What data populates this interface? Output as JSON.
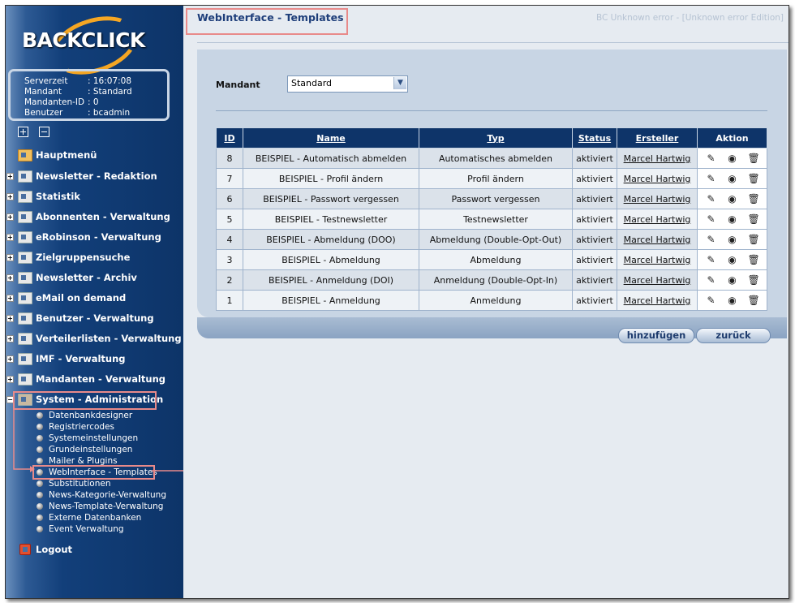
{
  "logo_text": "BACKCLICK",
  "info": {
    "rows": [
      {
        "key": "Serverzeit",
        "value": ": 16:07:08"
      },
      {
        "key": "Mandant",
        "value": ": Standard"
      },
      {
        "key": "Mandanten-ID",
        "value": ": 0"
      },
      {
        "key": "Benutzer",
        "value": ": bcadmin"
      }
    ]
  },
  "menu": [
    {
      "label": "Hauptmenü"
    },
    {
      "label": "Newsletter - Redaktion"
    },
    {
      "label": "Statistik"
    },
    {
      "label": "Abonnenten - Verwaltung"
    },
    {
      "label": "eRobinson - Verwaltung"
    },
    {
      "label": "Zielgruppensuche"
    },
    {
      "label": "Newsletter - Archiv"
    },
    {
      "label": "eMail on demand"
    },
    {
      "label": "Benutzer - Verwaltung"
    },
    {
      "label": "Verteilerlisten - Verwaltung"
    },
    {
      "label": "IMF - Verwaltung"
    },
    {
      "label": "Mandanten - Verwaltung"
    },
    {
      "label": "System - Administration"
    }
  ],
  "submenu": [
    "Datenbankdesigner",
    "Registriercodes",
    "Systemeinstellungen",
    "Grundeinstellungen",
    "Mailer & Plugins",
    "WebInterface - Templates",
    "Substitutionen",
    "News-Kategorie-Verwaltung",
    "News-Template-Verwaltung",
    "Externe Datenbanken",
    "Event Verwaltung"
  ],
  "logout_label": "Logout",
  "page_title": "WebInterface - Templates",
  "error_text": "BC Unknown error - [Unknown error Edition]",
  "mandant": {
    "label": "Mandant",
    "value": "Standard"
  },
  "table": {
    "headers": [
      "ID",
      "Name",
      "Typ",
      "Status",
      "Ersteller",
      "Aktion"
    ],
    "rows": [
      {
        "id": "8",
        "name": "BEISPIEL - Automatisch abmelden",
        "typ": "Automatisches abmelden",
        "status": "aktiviert",
        "ersteller": "Marcel Hartwig"
      },
      {
        "id": "7",
        "name": "BEISPIEL - Profil ändern",
        "typ": "Profil ändern",
        "status": "aktiviert",
        "ersteller": "Marcel Hartwig"
      },
      {
        "id": "6",
        "name": "BEISPIEL - Passwort vergessen",
        "typ": "Passwort vergessen",
        "status": "aktiviert",
        "ersteller": "Marcel Hartwig"
      },
      {
        "id": "5",
        "name": "BEISPIEL - Testnewsletter",
        "typ": "Testnewsletter",
        "status": "aktiviert",
        "ersteller": "Marcel Hartwig"
      },
      {
        "id": "4",
        "name": "BEISPIEL - Abmeldung (DOO)",
        "typ": "Abmeldung (Double-Opt-Out)",
        "status": "aktiviert",
        "ersteller": "Marcel Hartwig"
      },
      {
        "id": "3",
        "name": "BEISPIEL - Abmeldung",
        "typ": "Abmeldung",
        "status": "aktiviert",
        "ersteller": "Marcel Hartwig"
      },
      {
        "id": "2",
        "name": "BEISPIEL - Anmeldung (DOI)",
        "typ": "Anmeldung (Double-Opt-In)",
        "status": "aktiviert",
        "ersteller": "Marcel Hartwig"
      },
      {
        "id": "1",
        "name": "BEISPIEL - Anmeldung",
        "typ": "Anmeldung",
        "status": "aktiviert",
        "ersteller": "Marcel Hartwig"
      }
    ]
  },
  "buttons": {
    "add": "hinzufügen",
    "back": "zurück"
  },
  "colors": {
    "sidebar": "#0d3468",
    "header": "#0e3469",
    "highlight": "#e88a8a",
    "accent": "#f5a623"
  }
}
